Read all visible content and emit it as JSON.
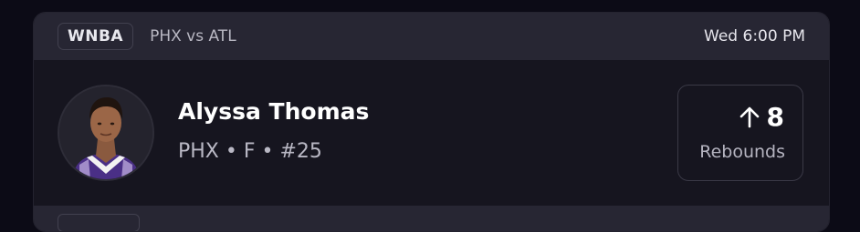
{
  "header": {
    "league": "WNBA",
    "matchup": "PHX vs ATL",
    "time": "Wed 6:00 PM"
  },
  "player": {
    "name": "Alyssa Thomas",
    "meta": "PHX • F • #25",
    "avatar_icon": "player-headshot"
  },
  "stat": {
    "direction_icon": "arrow-up-icon",
    "value": "8",
    "label": "Rebounds"
  },
  "colors": {
    "background": "#0c0b16",
    "card": "#16151f",
    "header": "#272633",
    "jersey": "#5b3a9e"
  }
}
